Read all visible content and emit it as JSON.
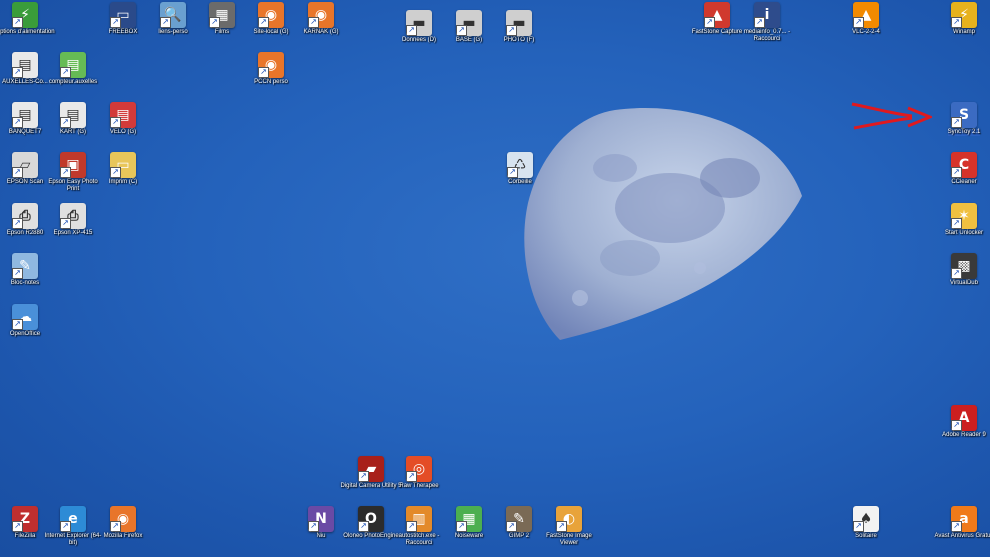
{
  "desktop": {
    "icons": [
      {
        "id": "options-alimentation",
        "label": "Options d'alimentation",
        "glyph": "battery-icon",
        "color": "#3a9c3a",
        "mark": "⚡"
      },
      {
        "id": "freebox",
        "label": "FREEBOX",
        "glyph": "monitor-icon",
        "color": "#2a4a8a",
        "mark": "▭"
      },
      {
        "id": "liens-perso",
        "label": "liens-perso",
        "glyph": "magnifier-icon",
        "color": "#6aa0d0",
        "mark": "🔍"
      },
      {
        "id": "films",
        "label": "Films",
        "glyph": "film-icon",
        "color": "#6b6b6b",
        "mark": "▦"
      },
      {
        "id": "site-local",
        "label": "Site-local (G)",
        "glyph": "firefox-icon",
        "color": "#e8752a",
        "mark": "◉"
      },
      {
        "id": "karnak",
        "label": "KARNAK (G)",
        "glyph": "firefox-icon",
        "color": "#e8752a",
        "mark": "◉"
      },
      {
        "id": "donnees",
        "label": "Donnees (D)",
        "glyph": "drive-icon",
        "color": "#cfcfcf",
        "mark": "▬"
      },
      {
        "id": "base",
        "label": "BASE (G)",
        "glyph": "drive-icon",
        "color": "#cfcfcf",
        "mark": "▬"
      },
      {
        "id": "photo",
        "label": "PHOTO (F)",
        "glyph": "drive-icon",
        "color": "#cfcfcf",
        "mark": "▬"
      },
      {
        "id": "faststone-capture",
        "label": "FastStone Capture",
        "glyph": "faststone-capture-icon",
        "color": "#d0392e",
        "mark": "▲"
      },
      {
        "id": "mediainfo",
        "label": "mediainfo_0.7... - Raccourci",
        "glyph": "mediainfo-icon",
        "color": "#2e4c8c",
        "mark": "i"
      },
      {
        "id": "vlc",
        "label": "VLC-2-2-4",
        "glyph": "vlc-icon",
        "color": "#f28a00",
        "mark": "▲"
      },
      {
        "id": "winamp",
        "label": "Winamp",
        "glyph": "winamp-icon",
        "color": "#e7b21d",
        "mark": "⚡"
      },
      {
        "id": "auxelles-co",
        "label": "AUXELLES-Co...",
        "glyph": "spreadsheet-icon",
        "color": "#e9e9e9",
        "mark": "▤"
      },
      {
        "id": "compteur-auxelles",
        "label": "compteur.auxelles",
        "glyph": "spreadsheet-icon",
        "color": "#66bb55",
        "mark": "▤"
      },
      {
        "id": "pccn-perso",
        "label": "PCCN perso",
        "glyph": "firefox-icon",
        "color": "#e8752a",
        "mark": "◉"
      },
      {
        "id": "banquet",
        "label": "BANQUET7",
        "glyph": "spreadsheet-icon",
        "color": "#e9e9e9",
        "mark": "▤"
      },
      {
        "id": "kart",
        "label": "KART (G)",
        "glyph": "spreadsheet-icon",
        "color": "#e9e9e9",
        "mark": "▤"
      },
      {
        "id": "velo",
        "label": "VELO (G)",
        "glyph": "spreadsheet-icon",
        "color": "#d23a3a",
        "mark": "▤"
      },
      {
        "id": "synctoy",
        "label": "SyncToy 2.1",
        "glyph": "synctoy-icon",
        "color": "#3b6bc2",
        "mark": "S"
      },
      {
        "id": "epson-scan",
        "label": "EPSON Scan",
        "glyph": "scanner-icon",
        "color": "#d8d8d8",
        "mark": "▱"
      },
      {
        "id": "epson-easy-photo",
        "label": "Epson Easy Photo Print",
        "glyph": "photo-print-icon",
        "color": "#c0392b",
        "mark": "▣"
      },
      {
        "id": "imprim",
        "label": "Imprim (C)",
        "glyph": "folder-icon",
        "color": "#e8c65a",
        "mark": "▭"
      },
      {
        "id": "corbeille",
        "label": "Corbeille",
        "glyph": "recycle-bin-icon",
        "color": "#d7e3ef",
        "mark": "♺"
      },
      {
        "id": "ccleaner",
        "label": "CCleaner",
        "glyph": "ccleaner-icon",
        "color": "#d6332a",
        "mark": "C"
      },
      {
        "id": "epson-r2880",
        "label": "Epson R2880",
        "glyph": "printer-icon",
        "color": "#e0e0e0",
        "mark": "⎙"
      },
      {
        "id": "epson-xp-415",
        "label": "Epson XP-415",
        "glyph": "printer-icon",
        "color": "#e0e0e0",
        "mark": "⎙"
      },
      {
        "id": "start-unlocker",
        "label": "Start Unlocker",
        "glyph": "wand-icon",
        "color": "#f0c040",
        "mark": "✶"
      },
      {
        "id": "bloc-notes",
        "label": "Bloc-notes",
        "glyph": "notepad-icon",
        "color": "#8fb8e0",
        "mark": "✎"
      },
      {
        "id": "virtualdub",
        "label": "VirtualDub",
        "glyph": "virtualdub-icon",
        "color": "#3a3a3a",
        "mark": "▩"
      },
      {
        "id": "openoffice",
        "label": "OpenOffice",
        "glyph": "openoffice-icon",
        "color": "#4a90d9",
        "mark": "☁"
      },
      {
        "id": "adobe-reader",
        "label": "Adobe Reader 9",
        "glyph": "pdf-icon",
        "color": "#cc1f1f",
        "mark": "A"
      },
      {
        "id": "digital-camera-utility",
        "label": "Digital Camera Utility 5",
        "glyph": "camera-utility-icon",
        "color": "#a8201a",
        "mark": "▰"
      },
      {
        "id": "rawtherapee",
        "label": "Raw Therapee",
        "glyph": "rawtherapee-icon",
        "color": "#e44d26",
        "mark": "◎"
      },
      {
        "id": "filezilla",
        "label": "FileZilla",
        "glyph": "filezilla-icon",
        "color": "#bf2f2f",
        "mark": "Z"
      },
      {
        "id": "internet-explorer",
        "label": "Internet Explorer (64-bit)",
        "glyph": "internet-explorer-icon",
        "color": "#2d8bd6",
        "mark": "e"
      },
      {
        "id": "mozilla-firefox",
        "label": "Mozilla Firefox",
        "glyph": "firefox-icon",
        "color": "#e8752a",
        "mark": "◉"
      },
      {
        "id": "niu",
        "label": "Niu",
        "glyph": "niu-icon",
        "color": "#6a4aa5",
        "mark": "N"
      },
      {
        "id": "oloneo",
        "label": "Oloneo PhotoEngine",
        "glyph": "oloneo-icon",
        "color": "#2c2c2c",
        "mark": "O"
      },
      {
        "id": "autostitch",
        "label": "autostitch.exe - Raccourci",
        "glyph": "autostitch-icon",
        "color": "#e38a2a",
        "mark": "▥"
      },
      {
        "id": "noiseware",
        "label": "Noiseware",
        "glyph": "noiseware-icon",
        "color": "#4caf50",
        "mark": "▦"
      },
      {
        "id": "gimp",
        "label": "GIMP 2",
        "glyph": "gimp-icon",
        "color": "#7a6a55",
        "mark": "✎"
      },
      {
        "id": "faststone-viewer",
        "label": "FastStone Image Viewer",
        "glyph": "faststone-viewer-icon",
        "color": "#e8a33a",
        "mark": "◐"
      },
      {
        "id": "solitaire",
        "label": "Solitaire",
        "glyph": "cards-icon",
        "color": "#f2f2f2",
        "mark": "♠"
      },
      {
        "id": "avast",
        "label": "Avast Antivirus Gratuit",
        "glyph": "avast-icon",
        "color": "#f07a1a",
        "mark": "a"
      }
    ],
    "annotation": {
      "glyph": "red-arrow-icon",
      "color": "#e0191e"
    },
    "moon": {
      "glyph": "moon-image"
    }
  }
}
